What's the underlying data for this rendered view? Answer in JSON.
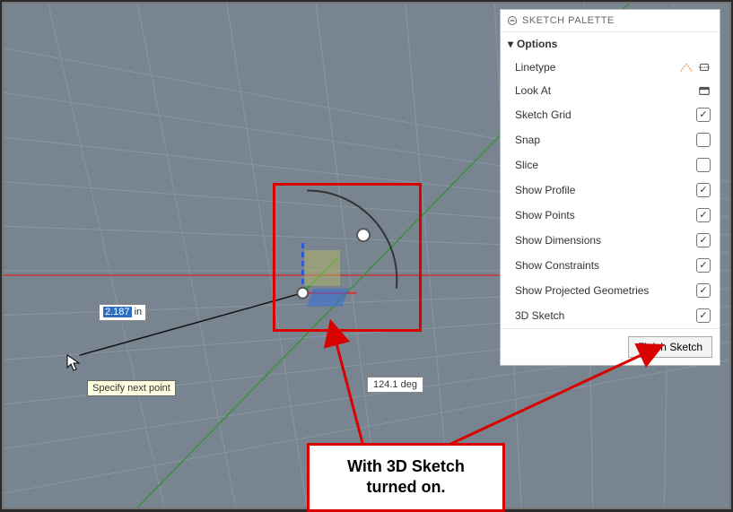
{
  "palette": {
    "title": "SKETCH PALETTE",
    "section": "Options",
    "rows": {
      "linetype": {
        "label": "Linetype",
        "kind": "icons"
      },
      "lookat": {
        "label": "Look At",
        "kind": "icon"
      },
      "grid": {
        "label": "Sketch Grid",
        "kind": "check",
        "checked": true
      },
      "snap": {
        "label": "Snap",
        "kind": "check",
        "checked": false
      },
      "slice": {
        "label": "Slice",
        "kind": "check",
        "checked": false
      },
      "profile": {
        "label": "Show Profile",
        "kind": "check",
        "checked": true
      },
      "points": {
        "label": "Show Points",
        "kind": "check",
        "checked": true
      },
      "dims": {
        "label": "Show Dimensions",
        "kind": "check",
        "checked": true
      },
      "constraints": {
        "label": "Show Constraints",
        "kind": "check",
        "checked": true
      },
      "proj": {
        "label": "Show Projected Geometries",
        "kind": "check",
        "checked": true
      },
      "sketch3d": {
        "label": "3D Sketch",
        "kind": "check",
        "checked": true
      }
    },
    "finish": "Finish Sketch"
  },
  "canvas": {
    "measurement_value": "2.187",
    "measurement_unit": "in",
    "angle": "124.1 deg",
    "tooltip": "Specify next point"
  },
  "annotation": {
    "text": "With 3D Sketch turned on."
  },
  "colors": {
    "accent_orange": "#e88c2e",
    "highlight_red": "#d90000",
    "measure_blue": "#2f6fbf"
  }
}
